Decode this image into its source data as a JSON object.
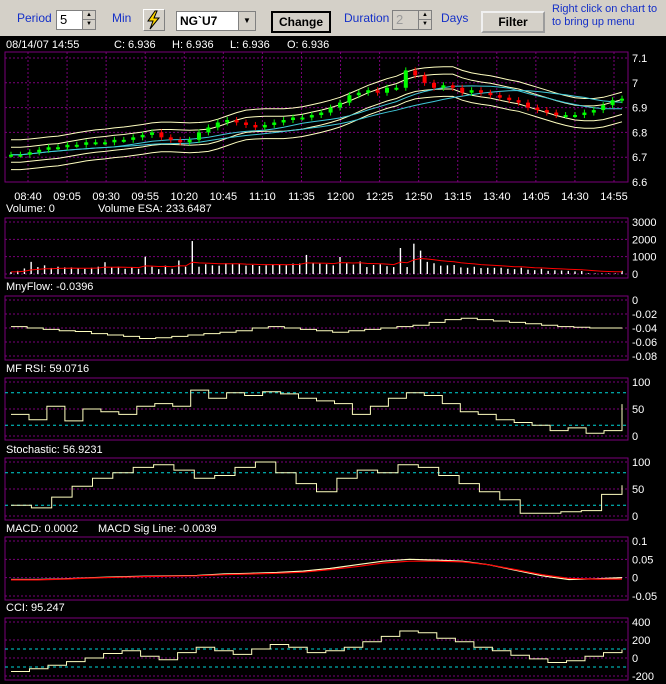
{
  "toolbar": {
    "period_label": "Period",
    "period_value": "5",
    "min_label": "Min",
    "symbol": "NG`U7",
    "change_label": "Change",
    "duration_label": "Duration",
    "duration_value": "2",
    "days_label": "Days",
    "filter_label": "Filter",
    "hint_line1": "Right click on chart to",
    "hint_line2": "to bring up menu",
    "bolt_icon": "lightning-icon"
  },
  "colors": {
    "up_candle": "#00ff00",
    "down_candle": "#ff0000",
    "band": "#ffffc0",
    "ma": "#40c8d8",
    "grid": "#7a007a",
    "signal": "#ff0000",
    "dashed_level": "#00d8d8",
    "bar": "#ffffff",
    "text": "#ffffff"
  },
  "price": {
    "header": {
      "datetime": "08/14/07 14:55",
      "close": "C: 6.936",
      "high": "H: 6.936",
      "low": "L: 6.936",
      "open": "O: 6.936"
    },
    "y_ticks": [
      "7.1",
      "7",
      "6.9",
      "6.8",
      "6.7",
      "6.6"
    ],
    "x_ticks": [
      "08:40",
      "09:05",
      "09:30",
      "09:55",
      "10:20",
      "10:45",
      "11:10",
      "11:35",
      "12:00",
      "12:25",
      "12:50",
      "13:15",
      "13:40",
      "14:05",
      "14:30",
      "14:55"
    ]
  },
  "chart_data": [
    {
      "type": "candlestick",
      "title": "NG`U7 5 Min",
      "x_ticks": [
        "08:40",
        "09:05",
        "09:30",
        "09:55",
        "10:20",
        "10:45",
        "11:10",
        "11:35",
        "12:00",
        "12:25",
        "12:50",
        "13:15",
        "13:40",
        "14:05",
        "14:30",
        "14:55"
      ],
      "ylim": [
        6.6,
        7.1
      ],
      "close": [
        6.71,
        6.71,
        6.72,
        6.73,
        6.74,
        6.74,
        6.75,
        6.75,
        6.76,
        6.76,
        6.76,
        6.77,
        6.77,
        6.78,
        6.79,
        6.8,
        6.78,
        6.77,
        6.76,
        6.77,
        6.8,
        6.82,
        6.84,
        6.85,
        6.84,
        6.83,
        6.82,
        6.83,
        6.84,
        6.85,
        6.86,
        6.86,
        6.87,
        6.88,
        6.9,
        6.92,
        6.95,
        6.96,
        6.97,
        6.96,
        6.98,
        6.98,
        7.05,
        7.03,
        7.0,
        6.98,
        6.99,
        6.98,
        6.96,
        6.97,
        6.96,
        6.95,
        6.94,
        6.93,
        6.92,
        6.9,
        6.89,
        6.88,
        6.87,
        6.87,
        6.87,
        6.88,
        6.89,
        6.91,
        6.93,
        6.936
      ]
    },
    {
      "type": "bar",
      "title": "Volume",
      "header": "Volume: 0",
      "header2": "Volume ESA: 233.6487",
      "y_ticks": [
        "3000",
        "2000",
        "1000",
        "0"
      ],
      "ylim": [
        0,
        3000
      ],
      "values": [
        120,
        180,
        320,
        700,
        400,
        500,
        350,
        420,
        380,
        380,
        320,
        300,
        360,
        420,
        680,
        380,
        420,
        300,
        380,
        300,
        1000,
        420,
        280,
        480,
        300,
        780,
        420,
        1900,
        420,
        560,
        500,
        480,
        620,
        560,
        580,
        480,
        520,
        460,
        500,
        560,
        560,
        500,
        600,
        600,
        1100,
        620,
        600,
        560,
        500,
        980,
        620,
        540,
        720,
        400,
        520,
        560,
        450,
        400,
        1500,
        400,
        1750,
        1350,
        700,
        620,
        480,
        500,
        520,
        380,
        360,
        420,
        340,
        360,
        360,
        360,
        300,
        280,
        360,
        250,
        220,
        300,
        180,
        210,
        200,
        180,
        150,
        170,
        40,
        30,
        30,
        30,
        30,
        180
      ]
    },
    {
      "type": "line",
      "title": "MnyFlow",
      "header": "MnyFlow: -0.0396",
      "y_ticks": [
        "0",
        "-0.02",
        "-0.04",
        "-0.06",
        "-0.08"
      ],
      "ylim": [
        -0.08,
        0
      ],
      "values": [
        -0.038,
        -0.04,
        -0.042,
        -0.044,
        -0.045,
        -0.048,
        -0.05,
        -0.052,
        -0.055,
        -0.054,
        -0.052,
        -0.05,
        -0.048,
        -0.046,
        -0.044,
        -0.04,
        -0.038,
        -0.04,
        -0.042,
        -0.044,
        -0.046,
        -0.044,
        -0.042,
        -0.04,
        -0.038,
        -0.036,
        -0.032,
        -0.028,
        -0.026,
        -0.028,
        -0.03,
        -0.032,
        -0.034,
        -0.036,
        -0.038,
        -0.039,
        -0.04,
        -0.04,
        -0.0396
      ]
    },
    {
      "type": "line",
      "title": "MF RSI",
      "header": "MF RSI: 59.0716",
      "y_ticks": [
        "100",
        "50",
        "0"
      ],
      "ylim": [
        0,
        100
      ],
      "levels": [
        80,
        20
      ],
      "values": [
        40,
        30,
        55,
        28,
        50,
        45,
        40,
        55,
        60,
        55,
        85,
        70,
        80,
        75,
        82,
        78,
        70,
        65,
        60,
        40,
        55,
        70,
        80,
        75,
        60,
        45,
        40,
        30,
        25,
        20,
        10,
        15,
        5,
        10,
        59
      ]
    },
    {
      "type": "line",
      "title": "Stochastic",
      "header": "Stochastic: 56.9231",
      "y_ticks": [
        "100",
        "50",
        "0"
      ],
      "ylim": [
        0,
        100
      ],
      "levels": [
        80,
        20
      ],
      "values": [
        20,
        15,
        35,
        55,
        70,
        80,
        90,
        95,
        85,
        70,
        75,
        90,
        100,
        80,
        60,
        45,
        70,
        85,
        80,
        95,
        90,
        75,
        60,
        45,
        30,
        5,
        5,
        8,
        10,
        40,
        57
      ]
    },
    {
      "type": "line",
      "title": "MACD",
      "header": "MACD: 0.0002",
      "header2": "MACD Sig Line: -0.0039",
      "y_ticks": [
        "0.1",
        "0.05",
        "0",
        "-0.05"
      ],
      "ylim": [
        -0.05,
        0.1
      ],
      "series": [
        {
          "name": "MACD",
          "values": [
            -0.005,
            -0.005,
            -0.003,
            0,
            0.002,
            0.004,
            0.005,
            0.006,
            0.01,
            0.012,
            0.014,
            0.018,
            0.025,
            0.035,
            0.045,
            0.05,
            0.048,
            0.045,
            0.035,
            0.02,
            0.005,
            -0.005,
            -0.003,
            0.0002
          ]
        },
        {
          "name": "MACD Sig Line",
          "values": [
            -0.006,
            -0.006,
            -0.004,
            -0.001,
            0.001,
            0.003,
            0.004,
            0.005,
            0.008,
            0.01,
            0.012,
            0.015,
            0.022,
            0.03,
            0.04,
            0.045,
            0.045,
            0.043,
            0.035,
            0.022,
            0.008,
            -0.002,
            -0.004,
            -0.0039
          ]
        }
      ]
    },
    {
      "type": "line",
      "title": "CCI",
      "header": "CCI: 95.247",
      "y_ticks": [
        "400",
        "200",
        "0",
        "-200"
      ],
      "ylim": [
        -200,
        400
      ],
      "levels": [
        100,
        -100
      ],
      "values": [
        -150,
        -120,
        -80,
        -40,
        0,
        50,
        80,
        20,
        -20,
        60,
        120,
        80,
        40,
        100,
        150,
        120,
        60,
        80,
        120,
        180,
        240,
        300,
        280,
        220,
        180,
        120,
        80,
        30,
        -10,
        -50,
        -30,
        20,
        60,
        95
      ]
    }
  ]
}
